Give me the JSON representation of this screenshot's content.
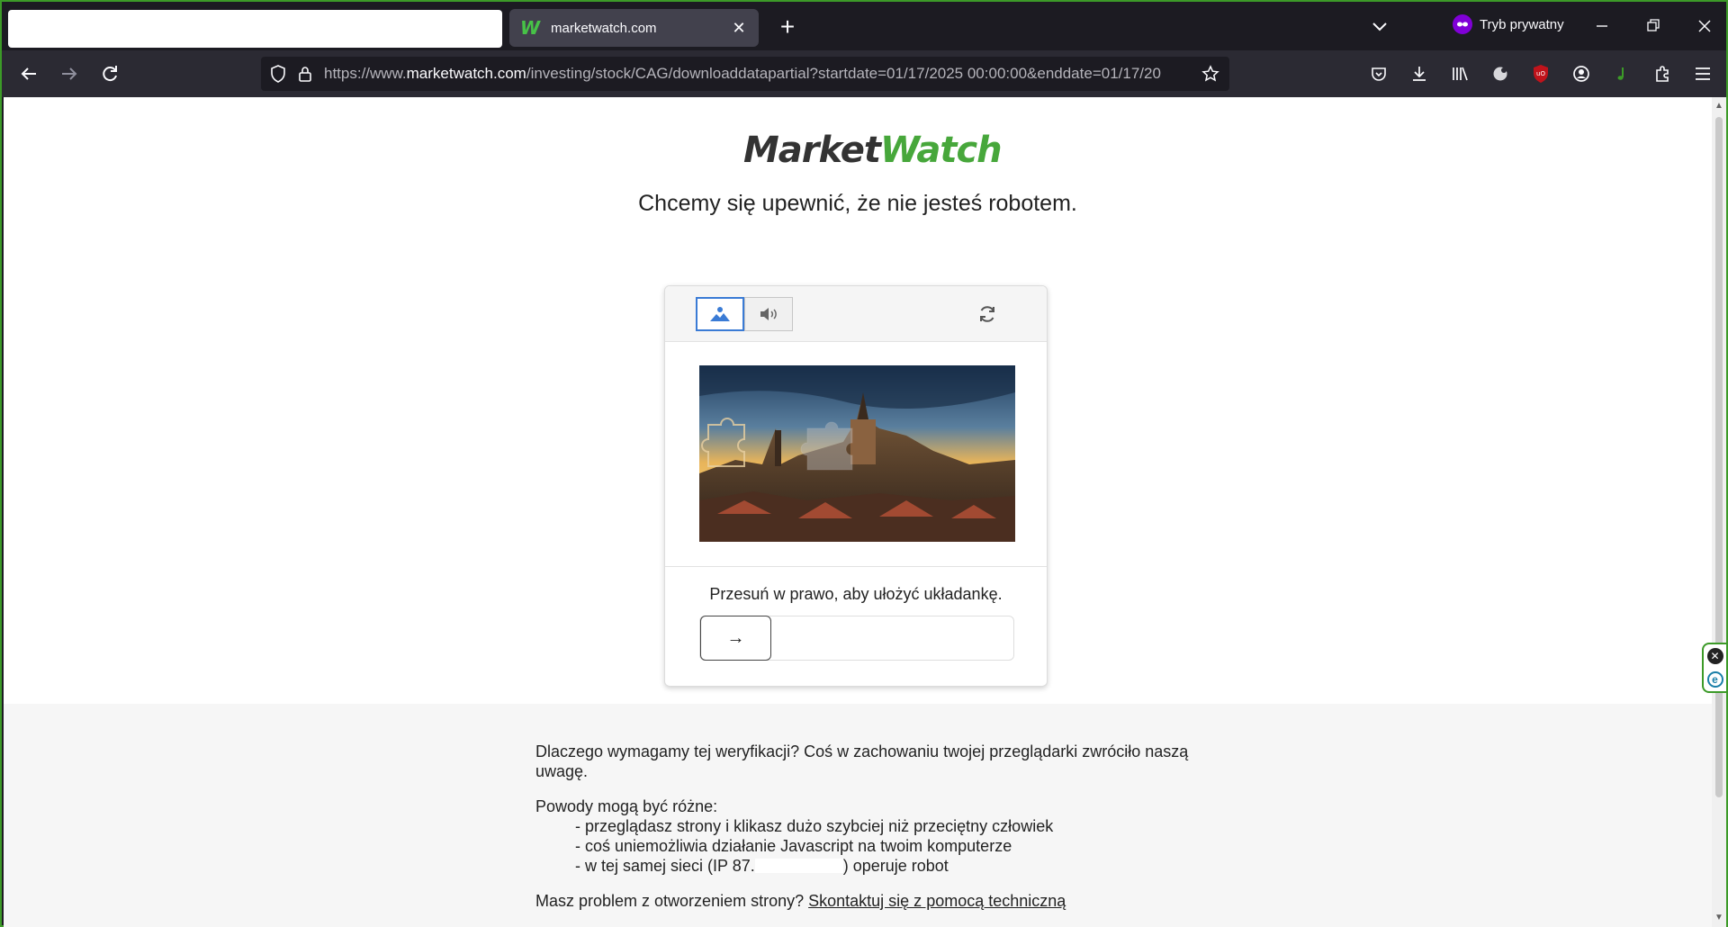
{
  "browser": {
    "tab": {
      "title": "marketwatch.com",
      "favicon": "W"
    },
    "private_label": "Tryb prywatny",
    "url": {
      "prefix": "https://www.",
      "host": "marketwatch.com",
      "path": "/investing/stock/CAG/downloaddatapartial?startdate=01/17/2025 00:00:00&enddate=01/17/20"
    }
  },
  "page": {
    "logo": {
      "part1": "Market",
      "part2": "Watch"
    },
    "headline": "Chcemy się upewnić, że nie jesteś robotem.",
    "captcha": {
      "instruction": "Przesuń w prawo, aby ułożyć układankę.",
      "handle_glyph": "→"
    },
    "info": {
      "why": "Dlaczego wymagamy tej weryfikacji? Coś w zachowaniu twojej przeglądarki zwróciło naszą uwagę.",
      "reasons_title": "Powody mogą być różne:",
      "reasons": [
        "- przeglądasz strony i klikasz dużo szybciej niż przeciętny człowiek",
        "- coś uniemożliwia działanie Javascript na twoim komputerze"
      ],
      "reason_ip_prefix": "- w tej samej sieci (IP 87.",
      "reason_ip_suffix": ") operuje robot",
      "problem_prefix": "Masz problem z otworzeniem strony?",
      "contact_link": "Skontaktuj się z pomocą techniczną"
    }
  },
  "colors": {
    "accent_green": "#47a73b",
    "frame_green": "#3c9a28",
    "private_purple": "#8000d7",
    "captcha_active_blue": "#3a7bd5"
  }
}
